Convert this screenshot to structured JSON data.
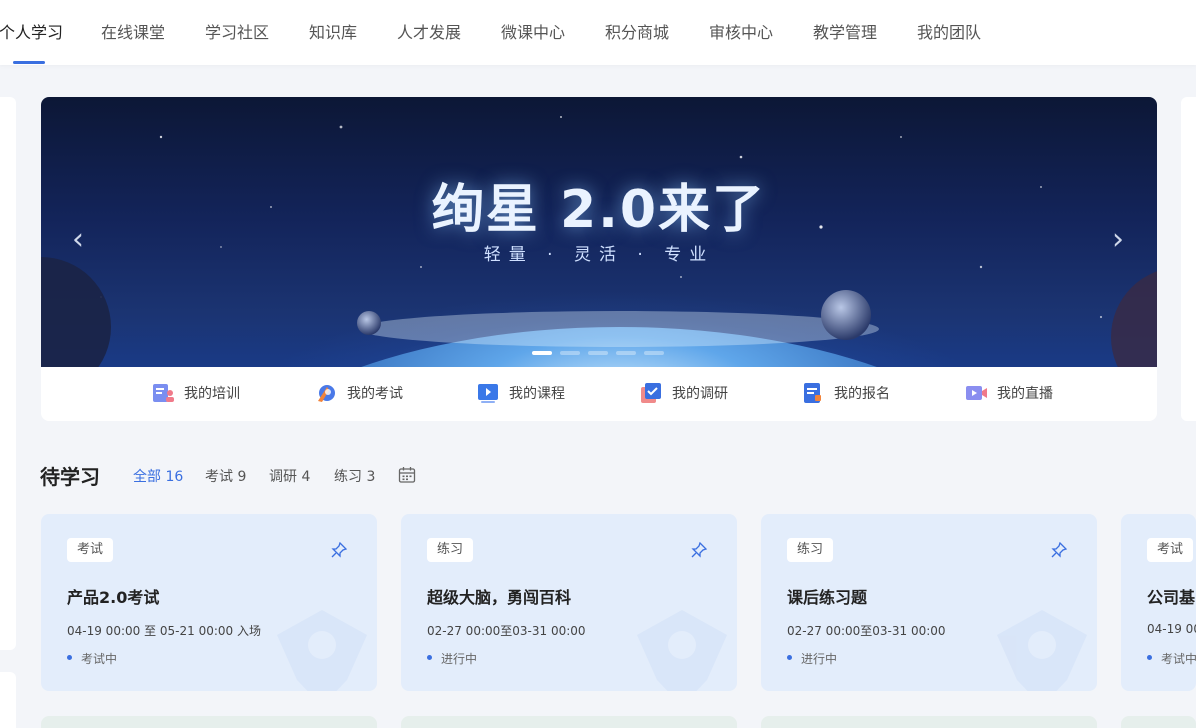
{
  "nav": {
    "items": [
      {
        "label": "个人学习",
        "active": true
      },
      {
        "label": "在线课堂"
      },
      {
        "label": "学习社区"
      },
      {
        "label": "知识库"
      },
      {
        "label": "人才发展"
      },
      {
        "label": "微课中心"
      },
      {
        "label": "积分商城"
      },
      {
        "label": "审核中心"
      },
      {
        "label": "教学管理"
      },
      {
        "label": "我的团队"
      }
    ],
    "accent_color": "#3a6fe0"
  },
  "banner": {
    "title": "绚星 2.0来了",
    "subtitle": "轻量 · 灵活 · 专业",
    "slide_count": 5,
    "active_slide": 1,
    "prev_icon": "chevron-left-icon",
    "next_icon": "chevron-right-icon"
  },
  "quick_links": [
    {
      "label": "我的培训",
      "icon": "training-icon"
    },
    {
      "label": "我的考试",
      "icon": "exam-icon"
    },
    {
      "label": "我的课程",
      "icon": "course-icon"
    },
    {
      "label": "我的调研",
      "icon": "survey-icon"
    },
    {
      "label": "我的报名",
      "icon": "signup-icon"
    },
    {
      "label": "我的直播",
      "icon": "live-icon"
    }
  ],
  "to_learn": {
    "title": "待学习",
    "filters": [
      {
        "label": "全部 16",
        "active": true
      },
      {
        "label": "考试 9"
      },
      {
        "label": "调研 4"
      },
      {
        "label": "练习 3"
      }
    ],
    "calendar_icon": "calendar-icon",
    "cards": [
      {
        "tag": "考试",
        "title": "产品2.0考试",
        "time": "04-19 00:00 至 05-21 00:00 入场",
        "status": "考试中"
      },
      {
        "tag": "练习",
        "title": "超级大脑，勇闯百科",
        "time": "02-27 00:00至03-31 00:00",
        "status": "进行中"
      },
      {
        "tag": "练习",
        "title": "课后练习题",
        "time": "02-27 00:00至03-31 00:00",
        "status": "进行中"
      },
      {
        "tag": "考试",
        "title": "公司基",
        "time": "04-19 00",
        "status": "考试中"
      }
    ]
  }
}
